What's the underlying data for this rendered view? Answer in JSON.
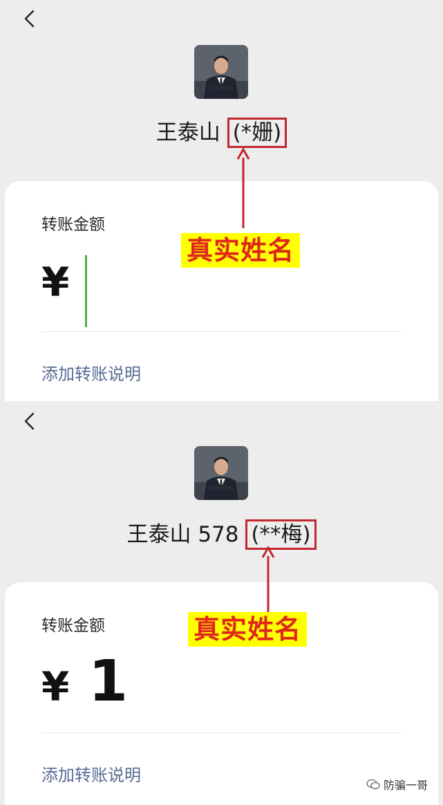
{
  "screens": [
    {
      "recipient_name": "王泰山",
      "recipient_suffix": "",
      "masked_real_name": "(*姗)",
      "amount_label": "转账金额",
      "currency_symbol": "¥",
      "amount_value": "",
      "note_link": "添加转账说明",
      "annotation": "真实姓名"
    },
    {
      "recipient_name": "王泰山",
      "recipient_suffix": "578",
      "masked_real_name": "(**梅)",
      "amount_label": "转账金额",
      "currency_symbol": "¥",
      "amount_value": "1",
      "note_link": "添加转账说明",
      "annotation": "真实姓名"
    }
  ],
  "watermark": "防骗一哥",
  "colors": {
    "highlight_border": "#c1272d",
    "annotation_bg": "#ffff00",
    "annotation_text": "#e0261b",
    "link": "#576b95",
    "cursor": "#4caf50"
  }
}
